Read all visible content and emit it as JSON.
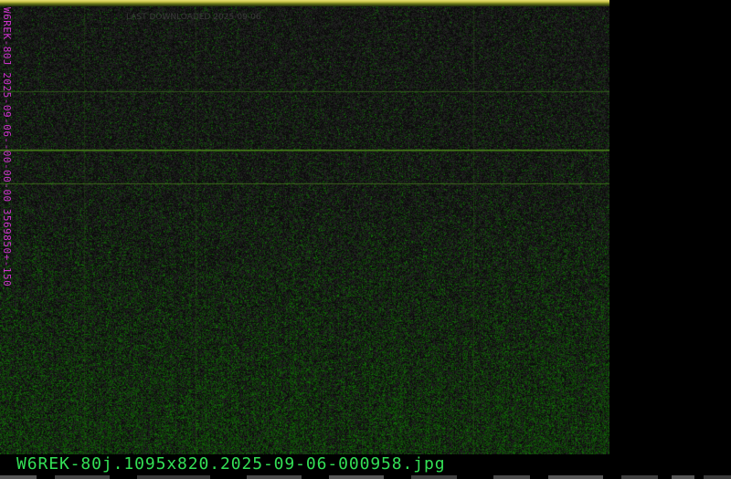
{
  "image": {
    "filename": "W6REK-80j.1095x820.2025-09-06-000958.jpg",
    "side_label": "W6REK-80J 2025-09-06--00-00-00 3569850+-150",
    "watermark": "LAST DOWNLOADED 2025-09-06"
  },
  "colors": {
    "background": "#000000",
    "noise_dark": "#1a1a1a",
    "signal_green": "#2f8a1e",
    "label_magenta": "#cc33cc",
    "filename_green": "#33e055",
    "top_band": "#e8e070"
  }
}
